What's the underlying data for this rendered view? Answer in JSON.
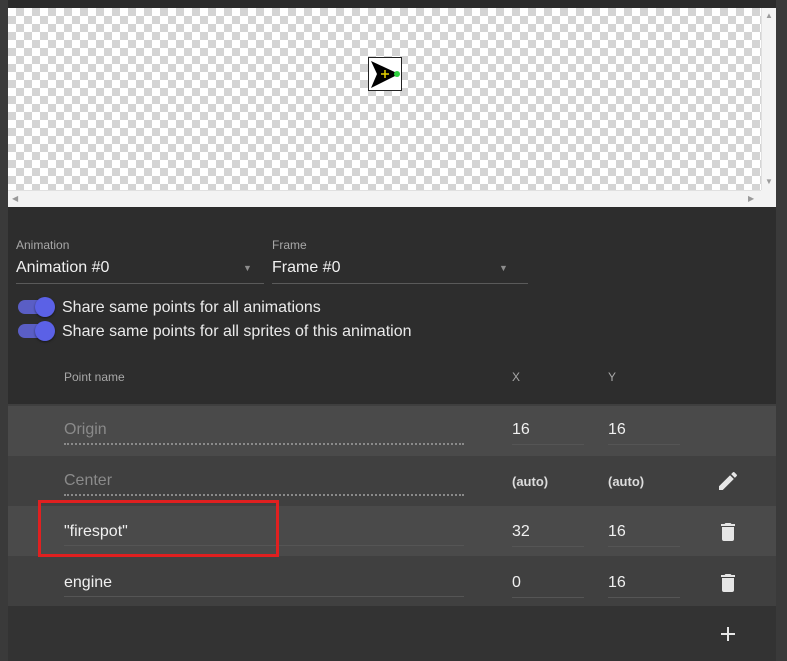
{
  "animation": {
    "label": "Animation",
    "value": "Animation #0"
  },
  "frame": {
    "label": "Frame",
    "value": "Frame #0"
  },
  "toggles": [
    {
      "label": "Share same points for all animations",
      "on": true
    },
    {
      "label": "Share same points for all sprites of this animation",
      "on": true
    }
  ],
  "table": {
    "headers": {
      "name": "Point name",
      "x": "X",
      "y": "Y"
    },
    "rows": [
      {
        "name": "Origin",
        "x": "16",
        "y": "16"
      },
      {
        "name": "Center",
        "x": "(auto)",
        "y": "(auto)"
      },
      {
        "name": "\"firespot\"",
        "x": "32",
        "y": "16"
      },
      {
        "name": "engine",
        "x": "0",
        "y": "16"
      }
    ]
  },
  "icons": {
    "edit": "pencil-icon",
    "delete": "trash-icon",
    "add": "plus-icon"
  },
  "colors": {
    "accent": "#5b61e6",
    "highlight": "#e02020"
  }
}
